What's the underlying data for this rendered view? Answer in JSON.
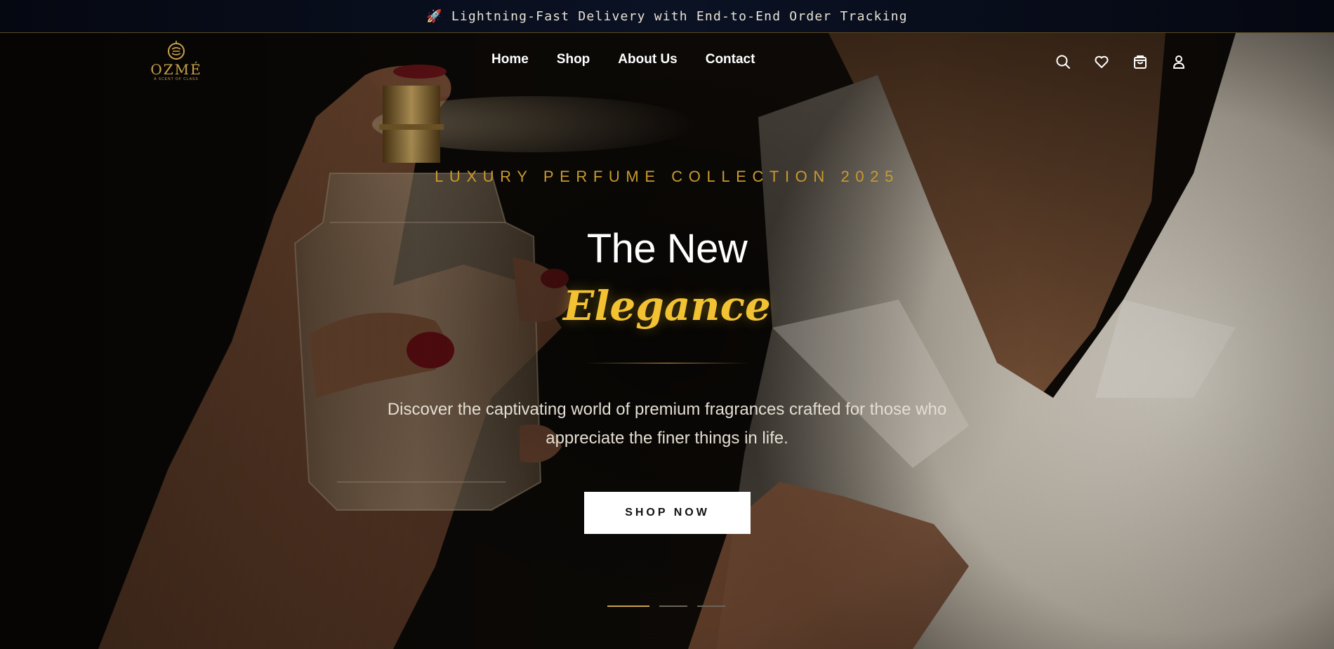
{
  "announcement": {
    "icon": "rocket-icon",
    "text": "Lightning-Fast Delivery with End-to-End Order Tracking"
  },
  "header": {
    "logo": {
      "wordmark": "OZMÉ",
      "tagline": "A SCENT OF CLASS",
      "color": "#c9a24a"
    },
    "nav": [
      {
        "label": "Home"
      },
      {
        "label": "Shop"
      },
      {
        "label": "About Us"
      },
      {
        "label": "Contact"
      }
    ],
    "icons": [
      "search-icon",
      "heart-icon",
      "shopping-bag-icon",
      "user-icon"
    ]
  },
  "hero": {
    "eyebrow": "LUXURY PERFUME COLLECTION 2025",
    "title_line1": "The New",
    "title_line2": "Elegance",
    "description": "Discover the captivating world of premium fragrances crafted for those who appreciate the finer things in life.",
    "cta_label": "SHOP NOW",
    "slides": {
      "count": 3,
      "active": 1
    },
    "accent_color": "#f2c233",
    "eyebrow_color": "#c99a2e"
  }
}
